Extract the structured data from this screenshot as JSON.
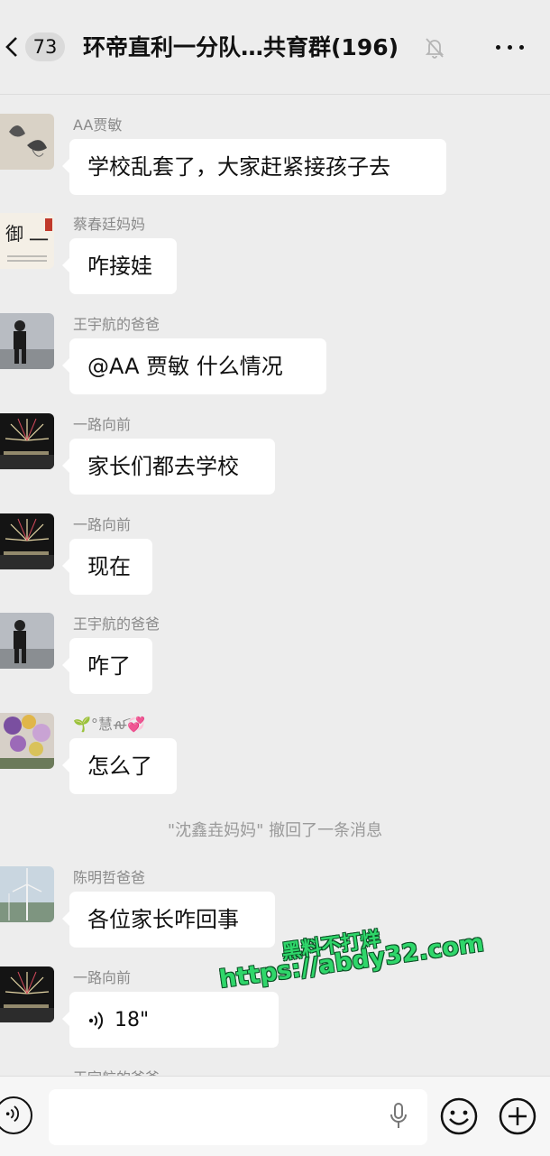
{
  "header": {
    "unread_count": "73",
    "title": "环帝直利一分队…共育群(196)"
  },
  "messages": [
    {
      "sender": "AA贾敏",
      "text": "学校乱套了，大家赶紧接孩子去",
      "avatar": "butterfly-avatar"
    },
    {
      "sender": "蔡春廷妈妈",
      "text": "咋接娃",
      "avatar": "calligraphy-avatar"
    },
    {
      "sender": "王宇航的爸爸",
      "text": "@AA 贾敏  什么情况",
      "avatar": "person-snow-avatar"
    },
    {
      "sender": "一路向前",
      "text": "家长们都去学校",
      "avatar": "fireworks-avatar"
    },
    {
      "sender": "一路向前",
      "text": "现在",
      "avatar": "fireworks-avatar"
    },
    {
      "sender": "王宇航的爸爸",
      "text": "咋了",
      "avatar": "person-snow-avatar"
    },
    {
      "sender": "🌱°慧ꫛ💞",
      "text": "怎么了",
      "avatar": "flowers-avatar"
    },
    {
      "sender": "陈明哲爸爸",
      "text": "各位家长咋回事",
      "avatar": "wind-turbine-avatar"
    },
    {
      "sender": "一路向前",
      "voice_duration": "18\"",
      "avatar": "fireworks-avatar"
    }
  ],
  "system_note": "\"沈鑫垚妈妈\" 撤回了一条消息",
  "cutoff_sender": "王宇航的爸爸",
  "watermark": {
    "line1": "黑料不打烊",
    "line2": "https://abdy32.com"
  },
  "colors": {
    "background": "#ededed",
    "bubble": "#ffffff",
    "watermark": "#2fd66a"
  }
}
